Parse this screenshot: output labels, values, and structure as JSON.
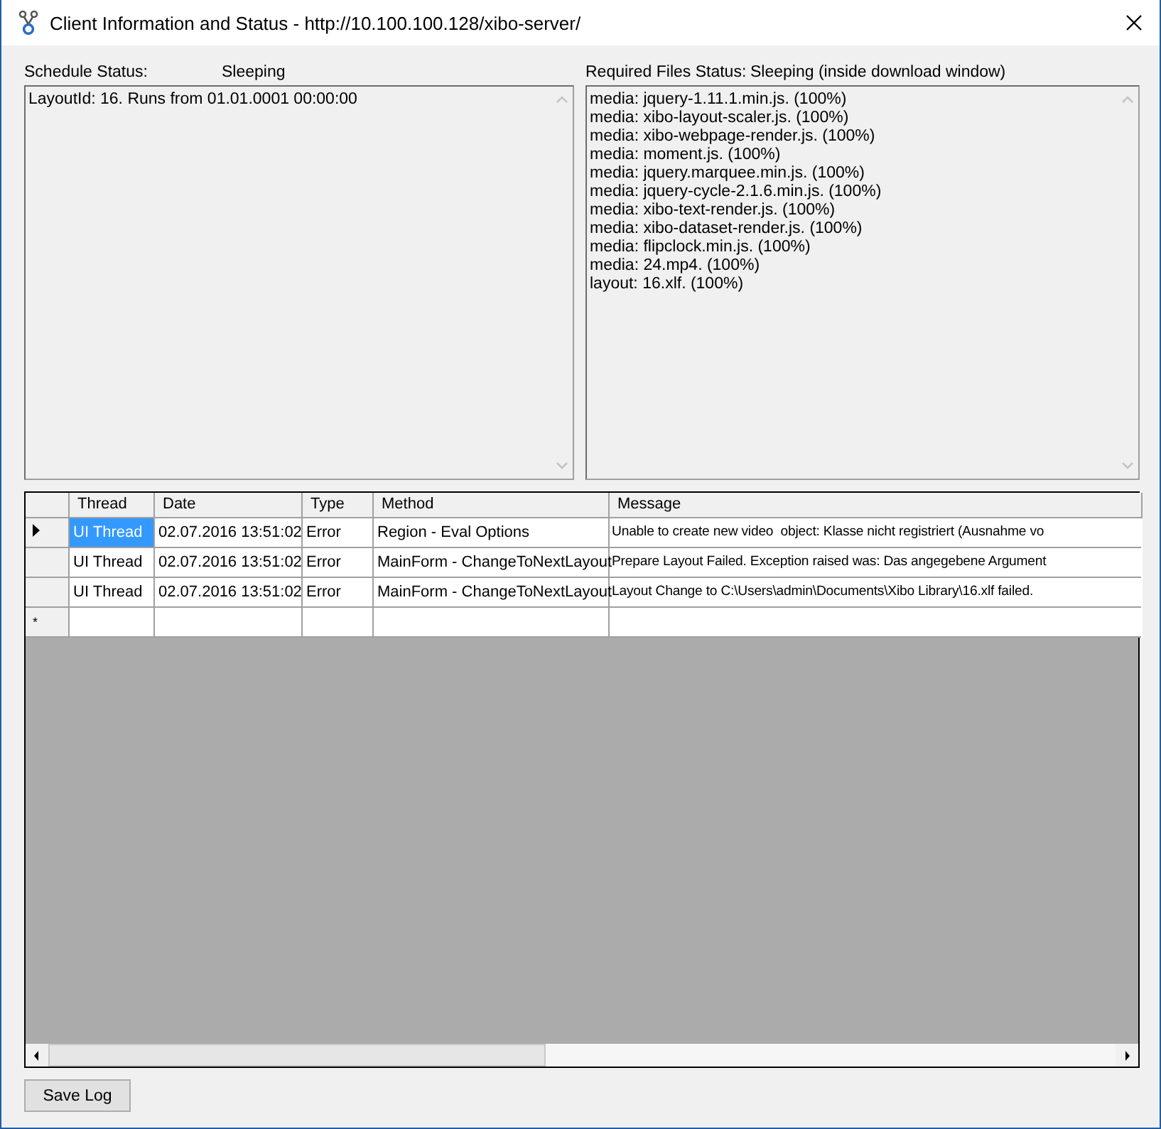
{
  "window": {
    "title": "Client Information and Status - http://10.100.100.128/xibo-server/"
  },
  "schedule_status": {
    "label": "Schedule Status:",
    "value": "Sleeping",
    "lines": [
      "LayoutId: 16. Runs from 01.01.0001 00:00:00"
    ]
  },
  "required_files_status": {
    "label": "Required Files Status:",
    "value": "Sleeping (inside download window)",
    "lines": [
      "media: jquery-1.11.1.min.js. (100%)",
      "media: xibo-layout-scaler.js. (100%)",
      "media: xibo-webpage-render.js. (100%)",
      "media: moment.js. (100%)",
      "media: jquery.marquee.min.js. (100%)",
      "media: jquery-cycle-2.1.6.min.js. (100%)",
      "media: xibo-text-render.js. (100%)",
      "media: xibo-dataset-render.js. (100%)",
      "media: flipclock.min.js. (100%)",
      "media: 24.mp4. (100%)",
      "layout: 16.xlf. (100%)"
    ]
  },
  "log_table": {
    "columns": [
      "Thread",
      "Date",
      "Type",
      "Method",
      "Message"
    ],
    "rows": [
      {
        "selected": true,
        "cells": [
          "UI Thread",
          "02.07.2016 13:51:02",
          "Error",
          "Region - Eval Options",
          "Unable to create new video  object: Klasse nicht registriert (Ausnahme vo"
        ]
      },
      {
        "selected": false,
        "cells": [
          "UI Thread",
          "02.07.2016 13:51:02",
          "Error",
          "MainForm - ChangeToNextLayout",
          "Prepare Layout Failed. Exception raised was: Das angegebene Argument"
        ]
      },
      {
        "selected": false,
        "cells": [
          "UI Thread",
          "02.07.2016 13:51:02",
          "Error",
          "MainForm - ChangeToNextLayout",
          "Layout Change to C:\\Users\\admin\\Documents\\Xibo Library\\16.xlf failed."
        ]
      }
    ],
    "new_row_marker": "*"
  },
  "buttons": [
    "Save Log"
  ]
}
